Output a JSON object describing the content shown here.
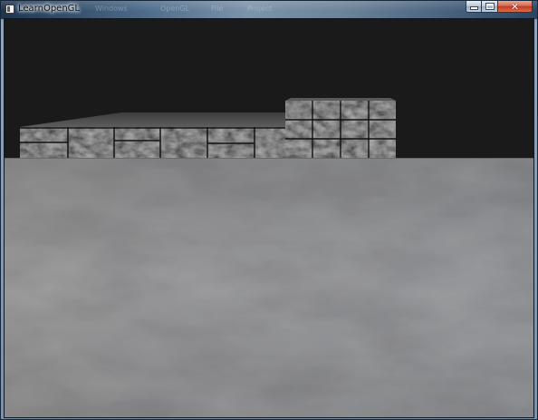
{
  "window": {
    "title": "LearnOpenGL",
    "background_title_text": [
      "Windows",
      "OpenGL",
      "File",
      "Project"
    ]
  },
  "icons": {
    "app": "app-window-icon",
    "minimize": "minimize-icon",
    "maximize": "maximize-icon",
    "close": "close-icon"
  },
  "controls": {
    "close_glyph": "✕"
  },
  "colors": {
    "clear_color": "#1a1a1a",
    "floor": "#57585a",
    "brick_face": "#3a3a3a",
    "brick_top": "#555555",
    "titlebar_dark": "#1e3550",
    "close_button": "#c4391f"
  }
}
